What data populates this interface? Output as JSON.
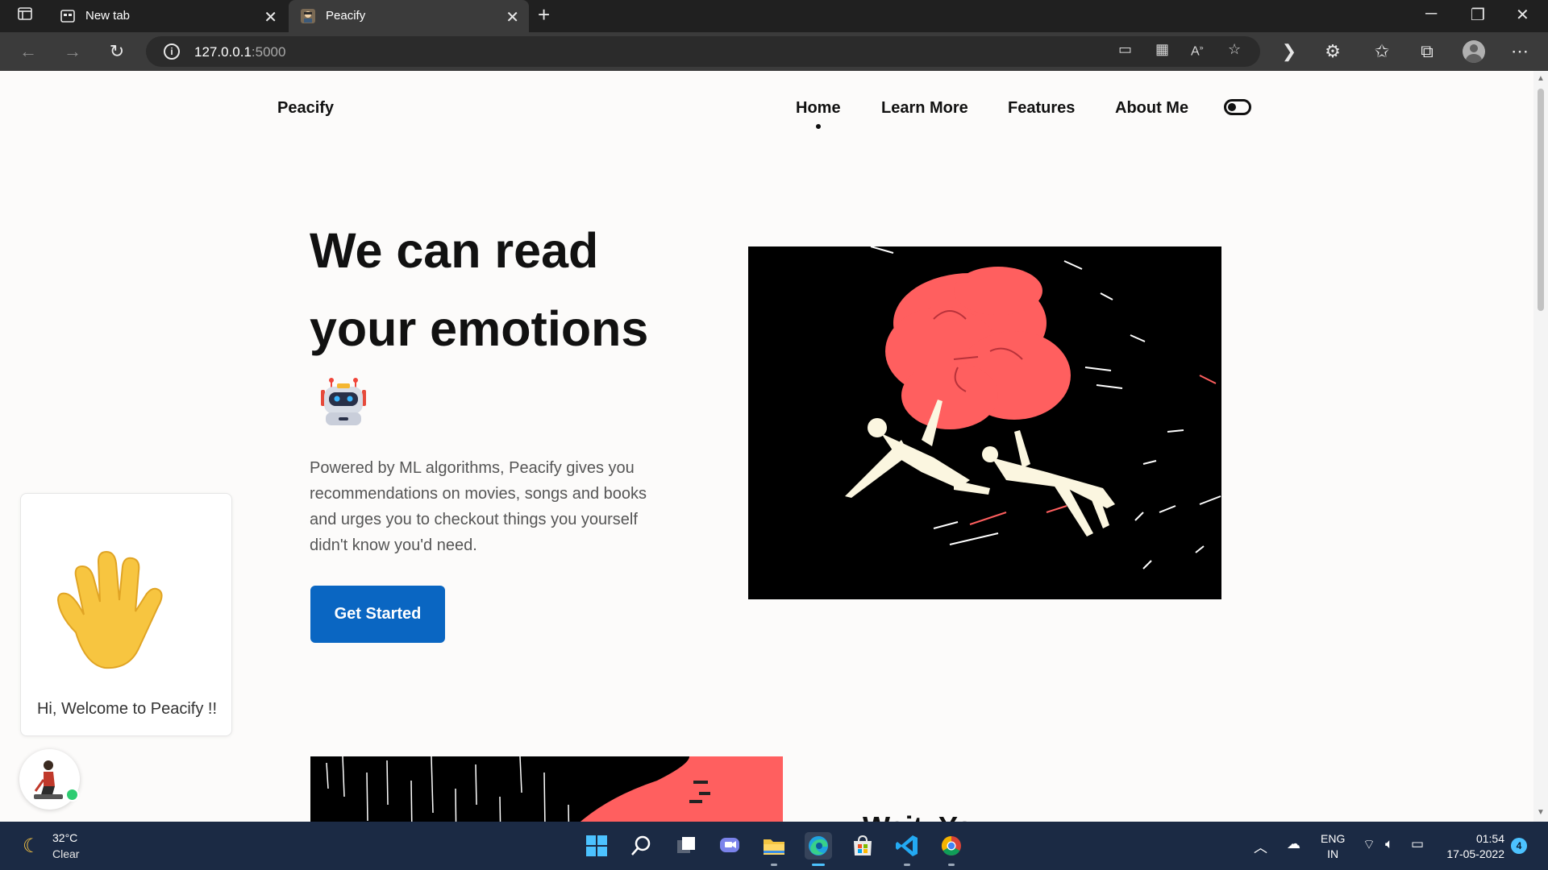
{
  "browser": {
    "tabs": [
      {
        "title": "New tab"
      },
      {
        "title": "Peacify"
      }
    ],
    "address": {
      "host": "127.0.0.1",
      "port": ":5000"
    }
  },
  "site": {
    "brand": "Peacify",
    "nav": [
      "Home",
      "Learn More",
      "Features",
      "About Me"
    ],
    "active_nav": "Home",
    "hero": {
      "title_line1": "We can read",
      "title_line2": "your emotions",
      "description": "Powered by ML algorithms, Peacify gives you recommendations on movies, songs and books and urges you to checkout things you yourself didn't know you'd need.",
      "cta": "Get Started"
    },
    "section2_title": "Wait, You",
    "chat_widget": {
      "welcome": "Hi, Welcome to Peacify !!",
      "status": "online"
    }
  },
  "taskbar": {
    "weather": {
      "temp": "32°C",
      "desc": "Clear"
    },
    "lang": {
      "line1": "ENG",
      "line2": "IN"
    },
    "time": "01:54",
    "date": "17-05-2022",
    "notifications": "4"
  },
  "colors": {
    "accent": "#0a66c2",
    "art_red": "#ff5f5f",
    "art_cream": "#fbf6e0",
    "taskbar": "#1b2a44"
  }
}
